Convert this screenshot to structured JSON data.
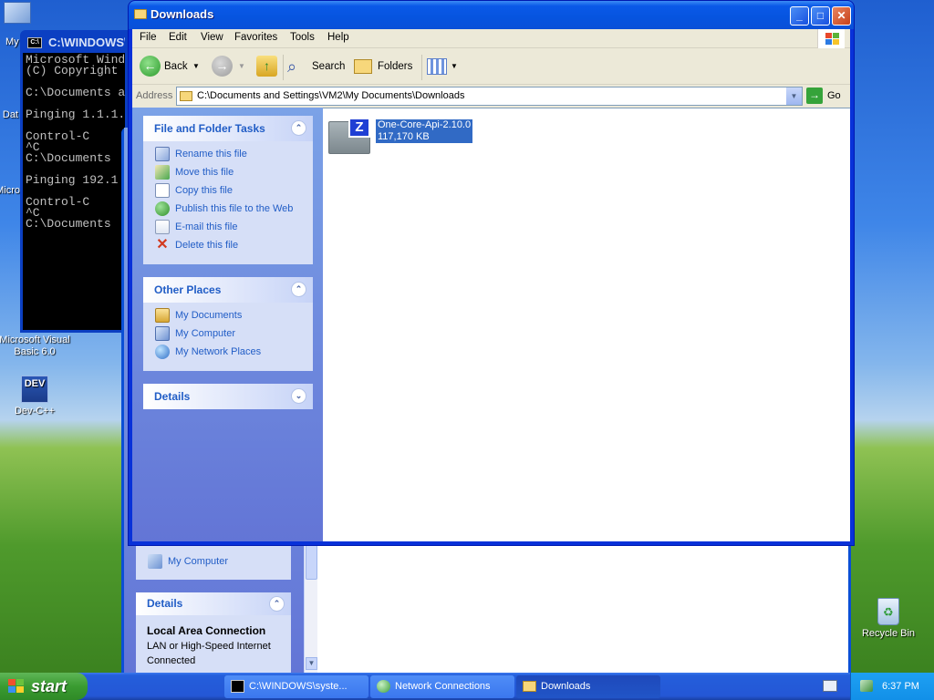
{
  "desktop": {
    "icons": [
      {
        "id": "my-computer",
        "label": "My"
      },
      {
        "id": "data",
        "label": "Dat"
      },
      {
        "id": "microsoft",
        "label": "Micro"
      },
      {
        "id": "vb6",
        "label": "Microsoft Visual Basic 6.0"
      },
      {
        "id": "devcpp",
        "label": "Dev-C++",
        "icon_text": "DEV"
      },
      {
        "id": "recycle",
        "label": "Recycle Bin"
      }
    ]
  },
  "cmd_window": {
    "title": "C:\\WINDOWS\\s",
    "icon_text": "C:\\",
    "lines": [
      "Microsoft Wind",
      "(C) Copyright ",
      "",
      "C:\\Documents a",
      "",
      "Pinging 1.1.1.",
      "",
      "Control-C",
      "^C",
      "C:\\Documents ",
      "",
      "Pinging 192.1",
      "",
      "Control-C",
      "^C",
      "C:\\Documents "
    ]
  },
  "network_window": {
    "other_item": "My Computer",
    "details_header": "Details",
    "details_title": "Local Area Connection",
    "details_line1": "LAN or High-Speed Internet",
    "details_line2": "Connected"
  },
  "downloads_window": {
    "title": "Downloads",
    "buttons": {
      "minimize": "_",
      "maximize": "□",
      "close": "✕"
    },
    "menu": [
      "File",
      "Edit",
      "View",
      "Favorites",
      "Tools",
      "Help"
    ],
    "toolbar": {
      "back": "Back",
      "search": "Search",
      "folders": "Folders"
    },
    "address": {
      "label": "Address",
      "value": "C:\\Documents and Settings\\VM2\\My Documents\\Downloads",
      "go": "Go"
    },
    "file_tasks": {
      "header": "File and Folder Tasks",
      "items": [
        "Rename this file",
        "Move this file",
        "Copy this file",
        "Publish this file to the Web",
        "E-mail this file",
        "Delete this file"
      ]
    },
    "other_places": {
      "header": "Other Places",
      "items": [
        "My Documents",
        "My Computer",
        "My Network Places"
      ]
    },
    "details": {
      "header": "Details"
    },
    "files": [
      {
        "name": "One-Core-Api-2.10.0",
        "size": "117,170 KB",
        "selected": true
      }
    ]
  },
  "taskbar": {
    "start": "start",
    "tasks": [
      {
        "label": "C:\\WINDOWS\\syste...",
        "active": false
      },
      {
        "label": "Network Connections",
        "active": false
      },
      {
        "label": "Downloads",
        "active": true
      }
    ],
    "clock": "6:37 PM"
  },
  "colors": {
    "xp_blue": "#0a59e8",
    "task_link": "#215dc6",
    "selection": "#316ac5"
  }
}
